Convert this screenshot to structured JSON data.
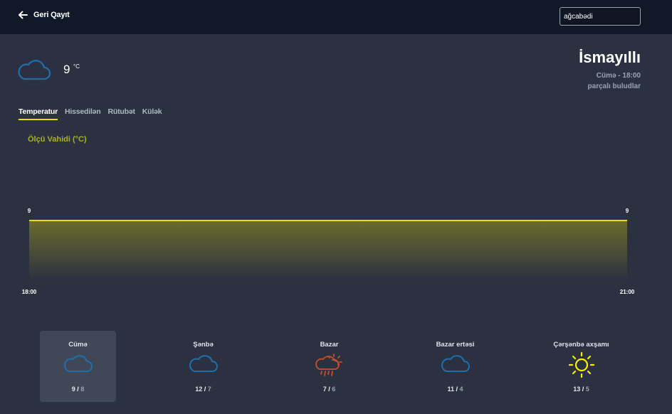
{
  "header": {
    "back_label": "Geri Qayıt",
    "search_value": "ağcabədi",
    "back_icon": "arrow-left-icon"
  },
  "current": {
    "temp": "9",
    "unit": "°C",
    "icon": "cloud-icon",
    "city": "İsmayıllı",
    "datetime": "Cümə - 18:00",
    "description": "parçalı buludlar"
  },
  "tabs": [
    "Temperatur",
    "Hissedilən",
    "Rütubət",
    "Külək"
  ],
  "active_tab": 0,
  "chart_label": "Ölçü Vahidi (°C)",
  "colors": {
    "accent_yellow": "#e7e000",
    "label_olive": "#a8b220",
    "cloud_blue": "#1f6fb0",
    "rain_orange": "#c6502a",
    "sun_yellow": "#f7f000",
    "background": "#2b3141",
    "topbar": "#111827"
  },
  "chart_data": {
    "type": "area",
    "title": "",
    "ylabel": "Ölçü Vahidi (°C)",
    "x": [
      "18:00",
      "21:00"
    ],
    "values": [
      9,
      9
    ],
    "data_labels": [
      "9",
      "9"
    ],
    "x_tick_labels": [
      "18:00",
      "21:00"
    ],
    "grid": false
  },
  "forecast": [
    {
      "day": "Cümə",
      "hi": "9",
      "lo": "8",
      "icon": "cloud-icon",
      "selected": true
    },
    {
      "day": "Şənbə",
      "hi": "12",
      "lo": "7",
      "icon": "cloud-icon"
    },
    {
      "day": "Bazar",
      "hi": "7",
      "lo": "6",
      "icon": "sun-rain-icon"
    },
    {
      "day": "Bazar ertəsi",
      "hi": "11",
      "lo": "4",
      "icon": "cloud-icon"
    },
    {
      "day": "Çərşənbə axşamı",
      "hi": "13",
      "lo": "5",
      "icon": "sun-icon"
    }
  ]
}
